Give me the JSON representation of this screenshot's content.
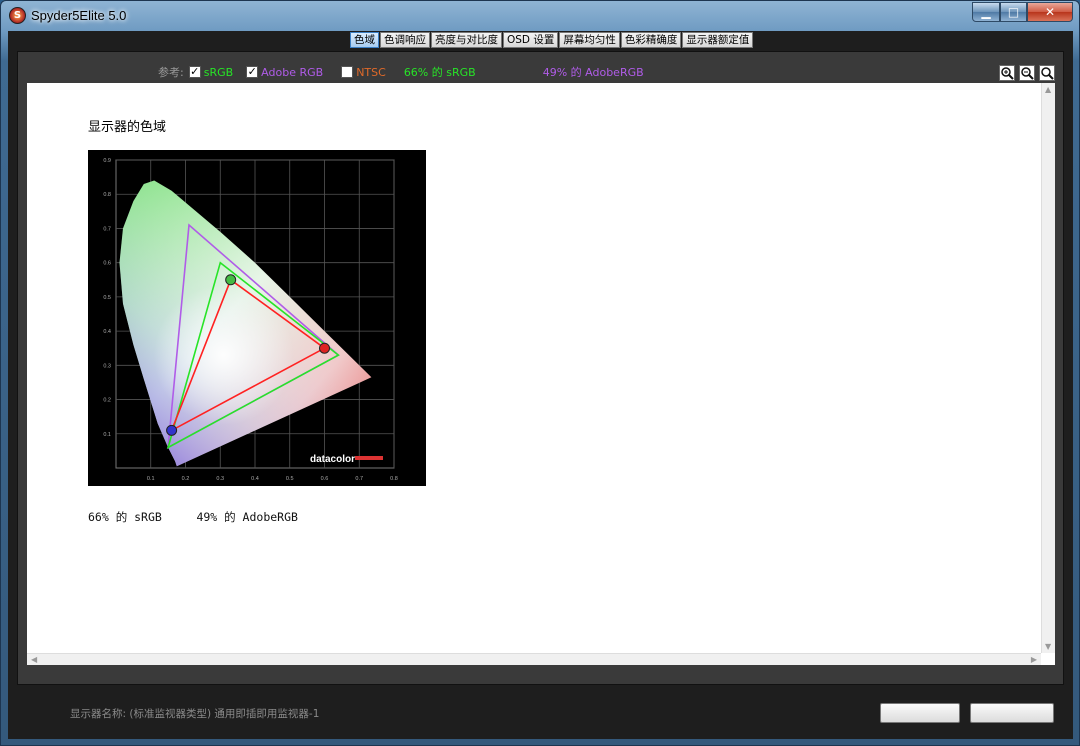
{
  "window": {
    "title": "Spyder5Elite 5.0",
    "app_icon_glyph": "S",
    "minimize_glyph": "▁",
    "maximize_glyph": "□",
    "close_glyph": "✕"
  },
  "tabs": [
    {
      "label": "色域",
      "active": true
    },
    {
      "label": "色调响应"
    },
    {
      "label": "亮度与对比度"
    },
    {
      "label": "OSD 设置"
    },
    {
      "label": "屏幕均匀性"
    },
    {
      "label": "色彩精确度"
    },
    {
      "label": "显示器额定值"
    }
  ],
  "reference": {
    "label": "参考:",
    "srgb": {
      "label": "sRGB",
      "checked": true,
      "color": "#27e427"
    },
    "adobe": {
      "label": "Adobe RGB",
      "checked": true,
      "color": "#b05ce8"
    },
    "ntsc": {
      "label": "NTSC",
      "checked": false,
      "color": "#e06a2a"
    },
    "srgb_stat": "66% 的 sRGB",
    "adobe_stat": "49% 的 AdobeRGB"
  },
  "zoom": {
    "zoom_in_icon": "zoom-in-icon",
    "zoom_out_icon": "zoom-out-icon",
    "zoom_fit_icon": "zoom-fit-icon"
  },
  "report": {
    "heading": "显示器的色域",
    "result_srgb": "66% 的 sRGB",
    "result_adobe": "49% 的 AdobeRGB",
    "chart_logo": "datacolor"
  },
  "footer": {
    "monitor_label": "显示器名称: (标准监视器类型) 通用即插即用监视器-1"
  },
  "chart_data": {
    "type": "scatter",
    "title": "",
    "xlabel": "",
    "ylabel": "",
    "xlim": [
      0,
      0.8
    ],
    "ylim": [
      0,
      0.9
    ],
    "x_ticks": [
      "0.1",
      "0.2",
      "0.3",
      "0.4",
      "0.5",
      "0.6",
      "0.7",
      "0.8"
    ],
    "y_ticks": [
      "0.1",
      "0.2",
      "0.3",
      "0.4",
      "0.5",
      "0.6",
      "0.7",
      "0.8",
      "0.9"
    ],
    "grid": true,
    "series": [
      {
        "color": "#b05ce8",
        "closed": true,
        "points": [
          [
            0.64,
            0.33
          ],
          [
            0.21,
            0.71
          ],
          [
            0.15,
            0.06
          ]
        ]
      },
      {
        "color": "#27e427",
        "closed": true,
        "points": [
          [
            0.64,
            0.33
          ],
          [
            0.3,
            0.6
          ],
          [
            0.15,
            0.06
          ]
        ]
      },
      {
        "color": "#ff2222",
        "closed": true,
        "points": [
          [
            0.6,
            0.35
          ],
          [
            0.33,
            0.55
          ],
          [
            0.16,
            0.11
          ]
        ]
      }
    ],
    "markers": [
      {
        "x": 0.6,
        "y": 0.35,
        "color": "#d22"
      },
      {
        "x": 0.33,
        "y": 0.55,
        "color": "#4b4"
      },
      {
        "x": 0.16,
        "y": 0.11,
        "color": "#33c"
      }
    ]
  }
}
